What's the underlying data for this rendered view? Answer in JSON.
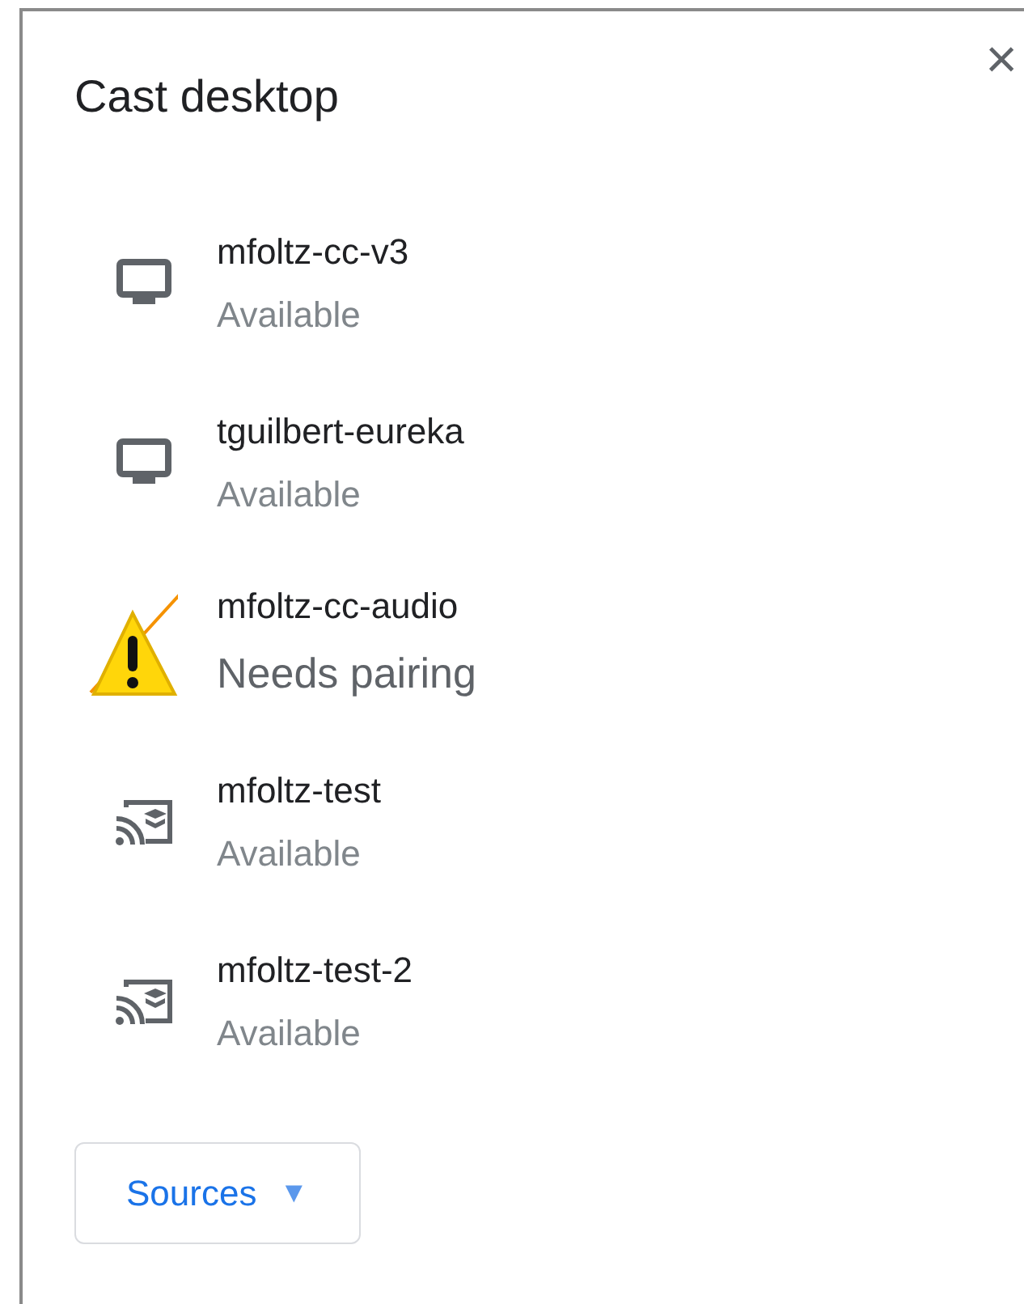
{
  "dialog": {
    "title": "Cast desktop",
    "close": "×"
  },
  "devices": [
    {
      "name": "mfoltz-cc-v3",
      "status": "Available",
      "kind": "tv"
    },
    {
      "name": "tguilbert-eureka",
      "status": "Available",
      "kind": "tv"
    },
    {
      "name": "mfoltz-cc-audio",
      "status": "Needs pairing",
      "kind": "warning"
    },
    {
      "name": "mfoltz-test",
      "status": "Available",
      "kind": "cast"
    },
    {
      "name": "mfoltz-test-2",
      "status": "Available",
      "kind": "cast"
    }
  ],
  "sources_button": {
    "label": "Sources",
    "caret": "▼"
  }
}
